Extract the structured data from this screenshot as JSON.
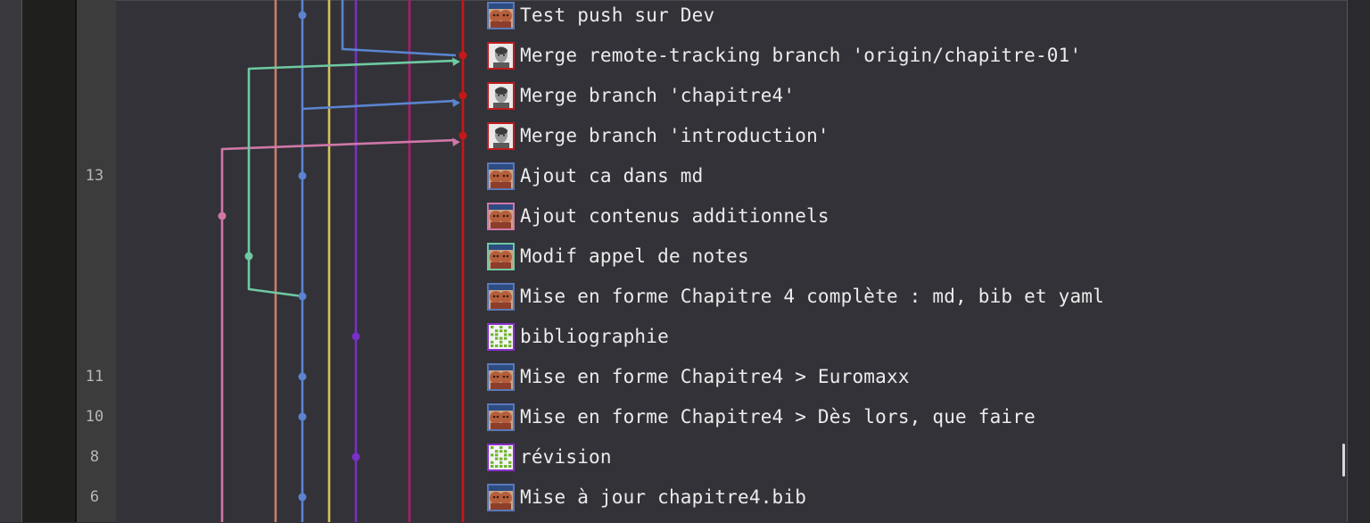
{
  "commits": [
    {
      "message": "Test push sur Dev",
      "avatar": "twins-avatar-icon",
      "avatar_border": "#5b78b8",
      "line_number": ""
    },
    {
      "message": "Merge remote-tracking branch 'origin/chapitre-01'",
      "avatar": "person-avatar-icon",
      "avatar_border": "#c01c1c",
      "line_number": ""
    },
    {
      "message": "Merge branch 'chapitre4'",
      "avatar": "person-avatar-icon",
      "avatar_border": "#c01c1c",
      "line_number": ""
    },
    {
      "message": "Merge branch 'introduction'",
      "avatar": "person-avatar-icon",
      "avatar_border": "#c01c1c",
      "line_number": ""
    },
    {
      "message": "Ajout ca dans md",
      "avatar": "twins-avatar-icon",
      "avatar_border": "#5b78b8",
      "line_number": "13"
    },
    {
      "message": "Ajout contenus additionnels",
      "avatar": "twins-avatar-icon",
      "avatar_border": "#d077a8",
      "line_number": ""
    },
    {
      "message": "Modif appel de notes",
      "avatar": "twins-avatar-icon",
      "avatar_border": "#6fc9a2",
      "line_number": ""
    },
    {
      "message": "Mise en forme Chapitre 4 complète : md, bib et yaml",
      "avatar": "twins-avatar-icon",
      "avatar_border": "#5b78b8",
      "line_number": ""
    },
    {
      "message": "bibliographie",
      "avatar": "identicon-avatar-icon",
      "avatar_border": "#8a2fc8",
      "line_number": ""
    },
    {
      "message": "Mise en forme Chapitre4 > Euromaxx",
      "avatar": "twins-avatar-icon",
      "avatar_border": "#5b78b8",
      "line_number": "11"
    },
    {
      "message": "Mise en forme Chapitre4 > Dès lors, que faire",
      "avatar": "twins-avatar-icon",
      "avatar_border": "#5b78b8",
      "line_number": "10"
    },
    {
      "message": "révision",
      "avatar": "identicon-avatar-icon",
      "avatar_border": "#8a2fc8",
      "line_number": "8"
    },
    {
      "message": "Mise à jour chapitre4.bib",
      "avatar": "twins-avatar-icon",
      "avatar_border": "#5b78b8",
      "line_number": "6"
    }
  ],
  "branch_colors": {
    "pink": "#d077a8",
    "salmon": "#d07a6a",
    "teal": "#6fc9a2",
    "blue": "#5b84d0",
    "yellow": "#d7c05a",
    "purple": "#7a2fc8",
    "magenta": "#b0196e",
    "red": "#c41818"
  }
}
